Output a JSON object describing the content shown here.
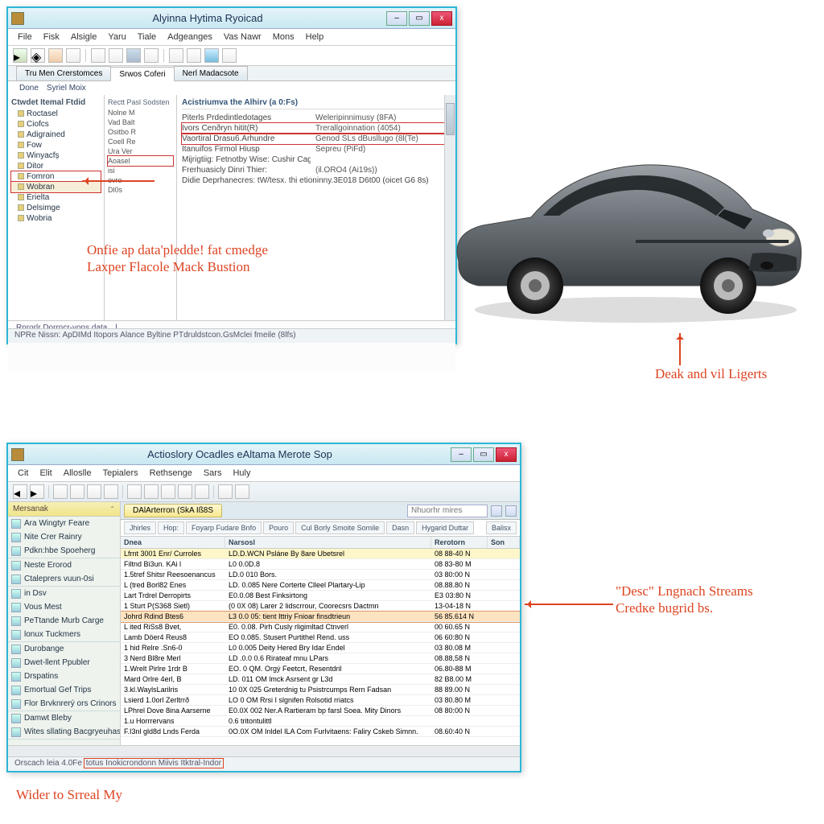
{
  "win1": {
    "title": "Alyinna Hytima Ryoicad",
    "window_buttons": {
      "min": "–",
      "max": "▭",
      "close": "x"
    },
    "menubar": [
      "File",
      "Fisk",
      "Alsigle",
      "Yaru",
      "Tiale",
      "Adgeanges",
      "Vas Nawr",
      "Mons",
      "Help"
    ],
    "tabs": [
      {
        "label": "Tru Men Crerstomces",
        "active": false
      },
      {
        "label": "Srwos Coferi",
        "active": true
      },
      {
        "label": "Nerl Madacsote",
        "active": false
      }
    ],
    "subbar": [
      {
        "label": "Done"
      },
      {
        "label": "Syriel Moix"
      }
    ],
    "tree": {
      "header": "Ctwdet Itemal Ftdid",
      "nodes": [
        {
          "label": "Roctasel"
        },
        {
          "label": "Ciofcs"
        },
        {
          "label": "Adigrained"
        },
        {
          "label": "Fow"
        },
        {
          "label": "Winyacfș"
        },
        {
          "label": "Ditor"
        },
        {
          "label": "Fomron",
          "boxed": true
        },
        {
          "label": "Wobran",
          "selected": true
        },
        {
          "label": "Erielta"
        },
        {
          "label": "Delsimge"
        },
        {
          "label": "Wobria"
        }
      ]
    },
    "midcol": {
      "header": "Rectt Pasl Sodsten",
      "lines": [
        {
          "label": "Nolne M"
        },
        {
          "label": "Vad Balt"
        },
        {
          "label": "Ositbo R"
        },
        {
          "label": "Coell Re"
        },
        {
          "label": "Ura Ver"
        },
        {
          "label": "Aoasel",
          "boxed": true
        },
        {
          "label": "isi"
        },
        {
          "label": "evro"
        },
        {
          "label": "Dl0s"
        }
      ]
    },
    "detail": {
      "header": "Acistriumva the Alhirv (a 0:Fs)",
      "rows": [
        {
          "lab": "Piterls Prdedintledotages",
          "val": "Weleripinnimusy (8FA)"
        },
        {
          "lab": "Ivors Cenðryn hitit(R)",
          "val": "Trerallgoinnation (4054)",
          "boxed": true
        },
        {
          "lab": "Vaortiral Drasu6.Arhundre",
          "val": "Genod SLs  dBusllugo (8l(Te)",
          "boxed": true
        },
        {
          "lab": "Itanuifos Firmol Hiusp",
          "val": "Sepreu (PiFd)"
        },
        {
          "lab": "Mijrigtiig: Fetnotby Wise: Cushir Cagforngsanuy loilres Hutas",
          "val": ""
        },
        {
          "lab": "Frerhuasicly Dinri Thier:",
          "val": "(il.ORO4 (Ai19s))"
        },
        {
          "lab": "Didie Deprhanecres: tW/tesx. thi etioninny.3E018 D6t00 (oicet G6 8s)",
          "val": ""
        }
      ]
    },
    "annot_header": "Rnrorlr Dorrncr-vons data…l",
    "statusbar": "NPRe Nissn: ApDIMd Itopors Alance Byltine PTdruldstcon.GsMclei fmeile (8lfs)"
  },
  "car_placeholder": "gray-sedan-illustration",
  "annotations": {
    "top": [
      "Onfie ap data'pledde! fat cmedge",
      "Laxper Flacole Mack Bustion"
    ],
    "car": "Deak and vil Ligerts",
    "right": [
      "\"Desc\" Lngnach Streams",
      "Credкe bugrid bs."
    ],
    "bottom": "Wider to Srreal My"
  },
  "win2": {
    "title": "Actioslory Ocadles eAltama Merote Sop",
    "window_buttons": {
      "min": "–",
      "max": "▭",
      "close": "x"
    },
    "menubar": [
      "Cit",
      "Elit",
      "Alloslle",
      "Tepialers",
      "Rethsenge",
      "Sars",
      "Huly"
    ],
    "doc_tab": "DAlArterron (SkA Iß8S",
    "search_placeholder": "Nhuorhr mires",
    "filterbar": [
      "Jhirles",
      "Hop:",
      "Foyarp Fudare Bnfo",
      "Pouro",
      "Cul Borly Smoite Somile",
      "Dasn",
      "Hygarid Duttar",
      "Balisx"
    ],
    "sidepanel": [
      {
        "header": "Mersanak",
        "items": [
          "Ara Wingtyr Feare",
          "Nite Crer Rainry",
          "Pdkn:hbe Spoeherg"
        ]
      },
      {
        "header": null,
        "items": [
          "Neste Erorod",
          "Ctaleprers vuun-0si"
        ]
      },
      {
        "header": null,
        "items": [
          "in Dsv",
          "Vous Mest",
          "PeTtande Murb Carge",
          "lonux Tuckmers"
        ]
      },
      {
        "header": null,
        "items": [
          "Durobange",
          "Dwet-llent Ppubler",
          "Drspatins",
          "Emortual Gef Trips",
          "Flor Brvknrerý ors Crinors"
        ]
      },
      {
        "header": null,
        "items": [
          "Damwt Bleby",
          "Wites sllating Bacgryeuhasy"
        ]
      }
    ],
    "table": {
      "columns": [
        "Dnea",
        "Narsosl",
        "Rerotorn",
        "Son"
      ],
      "rows": [
        {
          "c0": "Lfrnt 3001 Enr/ Curroles",
          "c1": "LD.D.WCN Psláne By 8are Ubetsrel",
          "c2": "08 88-40 N",
          "c3": "",
          "hl": true
        },
        {
          "c0": "Filtnd Bi3un. KAi l",
          "c1": "L0 0.0D.8",
          "c2": "08 83-80 M",
          "c3": ""
        },
        {
          "c0": "1.5tref Shitsr Reesoenancus",
          "c1": "LD.0 010 Bors.",
          "c2": "03 80:00 N",
          "c3": ""
        },
        {
          "c0": "L (tred Borl82 Enes",
          "c1": "LD. 0.085 Nere Corterte Clleel Plartary-Lip",
          "c2": "08.88.80 N",
          "c3": ""
        },
        {
          "c0": "Lart Trdrel Derropirts",
          "c1": "E0.0.08 Best Finksirtong",
          "c2": "E3 03:80 N",
          "c3": ""
        },
        {
          "c0": "1 Sturt P(S368 Sietl)",
          "c1": "(0 0X 08) Larer 2 lidscrrour, Coorecsrs Dactmn",
          "c2": "13-04-18 N",
          "c3": ""
        },
        {
          "c0": "Johrd Rdind Btes6",
          "c1": "L3 0.0 05: tient Ittriy Fnioar finsdtrieun",
          "c2": "56 85.614 N",
          "c3": "",
          "hlred": true
        },
        {
          "c0": "L ited RiSs8 Bvet,",
          "c1": "E0. 0.08. Pirh Cusly rligimltad Ctnverl",
          "c2": "00 60.65 N",
          "c3": ""
        },
        {
          "c0": "Lamb Döer4 Reus8",
          "c1": "EO 0.085. Stusert Purtithel Rend. uss",
          "c2": "06 60:80 N",
          "c3": ""
        },
        {
          "c0": "1 hid Relre .Sn6-0",
          "c1": "L0 0.005 Deity Hered Bry Idar Endel",
          "c2": "03 80.08 M",
          "c3": ""
        },
        {
          "c0": "3 Nerd Bl8re Merl",
          "c1": "LD .0.0 0.6 Rirateaf mnu LPars",
          "c2": "08.88,58 N",
          "c3": ""
        },
        {
          "c0": "1.Wrelt Pirlre 1rdr B",
          "c1": "EO. 0 QM. Orgý Feetcrt, Resentdril",
          "c2": "06.80-88 M",
          "c3": ""
        },
        {
          "c0": "Mard Orlre 4erl, B",
          "c1": "LD. 011 OM lmck Asrsent gr L3d",
          "c2": "82 B8.00 M",
          "c3": ""
        },
        {
          "c0": "3.kl.WaylsLarilris",
          "c1": "10 0X 025 Greterdnig tu Psistrcumps Rern Fadsan",
          "c2": "88 89.00 N",
          "c3": ""
        },
        {
          "c0": "Lsierd 1.0orl Zerltrrð",
          "c1": "LO 0 OM Rrsi  I slgnifen Rolsotid rriatcs",
          "c2": "03 80.80 M",
          "c3": ""
        },
        {
          "c0": "LPhrel Dove 8ina Aarserne",
          "c1": "E0.0X 002 Ner.A Rartieram bp farsl Soea. Mity Dinors",
          "c2": "08 80:00 N",
          "c3": ""
        },
        {
          "c0": "1.u Horrrervans",
          "c1": "0.6 tritontulittl",
          "c2": "",
          "c3": ""
        },
        {
          "c0": "F.I3nl gld8d Lnds Ferda",
          "c1": "0O.0X OM Inldel ILA Com Furlvitaens: Faliry Cskeb Simnn.",
          "c2": "08.60:40 N",
          "c3": ""
        }
      ]
    },
    "statusbar_pre": "Orscach leia 4.0Fe",
    "statusbar_hl": "totus Inokicrondonn Miivis Itktral-Indor"
  }
}
